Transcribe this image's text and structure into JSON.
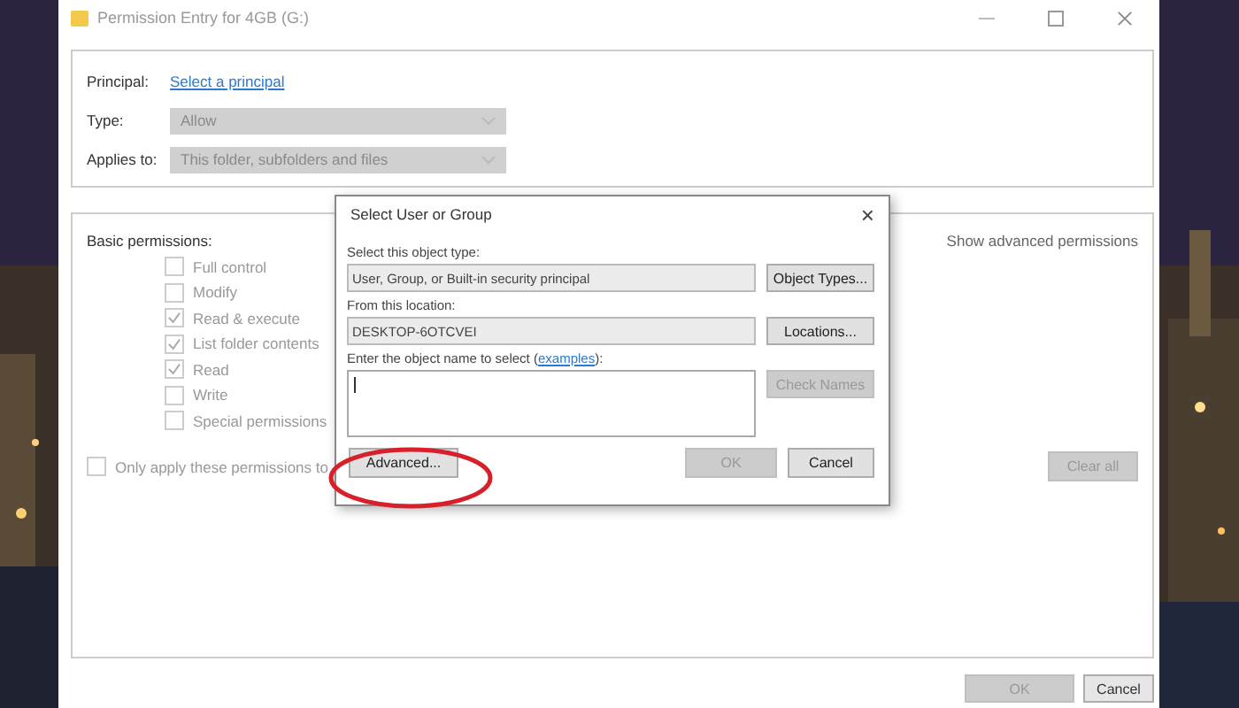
{
  "window": {
    "title": "Permission Entry for 4GB (G:)"
  },
  "principal": {
    "label": "Principal:",
    "link": "Select a principal"
  },
  "fields": [
    {
      "label": "Type:",
      "value": "Allow",
      "disabled": true
    },
    {
      "label": "Applies to:",
      "value": "This folder, subfolders and files",
      "disabled": true
    }
  ],
  "basic_permissions": {
    "label": "Basic permissions:",
    "show_advanced": "Show advanced permissions",
    "items": [
      {
        "label": "Full control",
        "checked": false
      },
      {
        "label": "Modify",
        "checked": false
      },
      {
        "label": "Read & execute",
        "checked": true
      },
      {
        "label": "List folder contents",
        "checked": true
      },
      {
        "label": "Read",
        "checked": true
      },
      {
        "label": "Write",
        "checked": false
      },
      {
        "label": "Special permissions",
        "checked": false
      }
    ]
  },
  "only_apply": {
    "label": "Only apply these permissions to",
    "checked": false
  },
  "clear_all": {
    "label": "Clear all",
    "disabled": true
  },
  "buttons": [
    {
      "label": "OK",
      "disabled": true
    },
    {
      "label": "Cancel",
      "disabled": false
    }
  ],
  "dialog": {
    "title": "Select User or Group",
    "close": "×",
    "rows": [
      {
        "label": "Select this object type:",
        "value": "User, Group, or Built-in security principal",
        "button": "Object Types..."
      },
      {
        "label": "From this location:",
        "value": "DESKTOP-6OTCVEI",
        "button": "Locations..."
      }
    ],
    "enter": {
      "prefix": "Enter the object name to select (",
      "link": "examples",
      "suffix": "):"
    },
    "check_names": {
      "label": "Check Names",
      "disabled": true
    },
    "advanced": {
      "label": "Advanced...",
      "highlighted": true
    },
    "buttons": [
      {
        "label": "OK",
        "disabled": true
      },
      {
        "label": "Cancel",
        "disabled": false
      }
    ]
  }
}
